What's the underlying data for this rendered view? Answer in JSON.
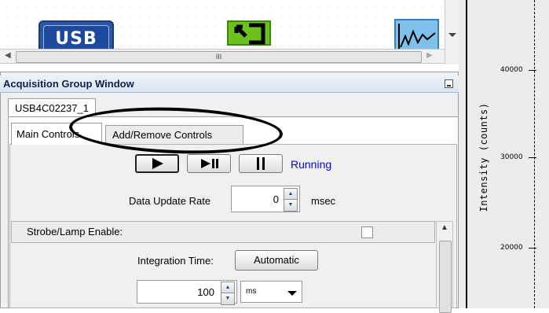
{
  "toolbar": {
    "usb_label": "USB",
    "hscroll_grip": "III"
  },
  "window": {
    "title": "Acquisition Group Window"
  },
  "device_tab": "USB4C02237_1",
  "tabs": [
    {
      "label": "Main Controls",
      "active": true
    },
    {
      "label": "Add/Remove Controls",
      "active": false
    }
  ],
  "controls": {
    "status": "Running",
    "data_update_rate_label": "Data Update Rate",
    "data_update_rate_value": "0",
    "data_update_rate_unit": "msec",
    "strobe_label": "Strobe/Lamp Enable:",
    "integration_label": "Integration Time:",
    "automatic_button": "Automatic",
    "integration_value": "100",
    "integration_unit": "ms"
  },
  "graph": {
    "ylabel": "Intensity (counts)",
    "ticks": [
      "40000",
      "30000",
      "20000"
    ]
  },
  "colors": {
    "status": "#0000ee",
    "usb_icon": "#2a57a6",
    "green_icon": "#6cc11e",
    "blue_icon": "#7fc1ea"
  }
}
